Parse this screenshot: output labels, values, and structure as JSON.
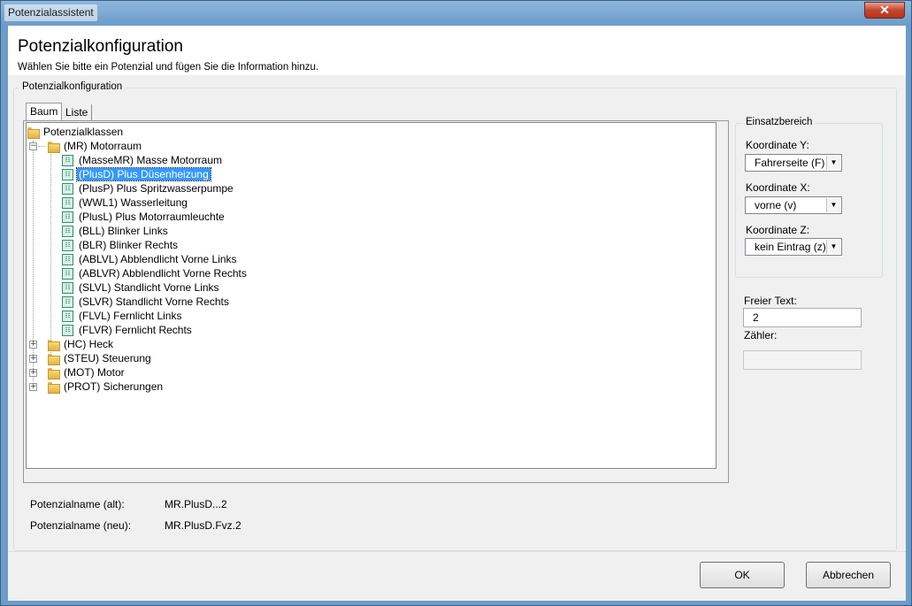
{
  "window": {
    "title": "Potenzialassistent",
    "close_label": "✕"
  },
  "header": {
    "title": "Potenzialkonfiguration",
    "subtitle": "Wählen Sie bitte ein Potenzial und fügen Sie die Information hinzu."
  },
  "config_group": {
    "title": "Potenzialkonfiguration"
  },
  "tabs": [
    {
      "label": "Baum",
      "active": true
    },
    {
      "label": "Liste",
      "active": false
    }
  ],
  "tree": {
    "root_label": "Potenzialklassen",
    "expanded_node": "(MR) Motorraum",
    "children": [
      {
        "label": "(MasseMR) Masse Motorraum"
      },
      {
        "label": "(PlusD) Plus Düsenheizung",
        "selected": true
      },
      {
        "label": "(PlusP) Plus Spritzwasserpumpe"
      },
      {
        "label": "(WWL1) Wasserleitung"
      },
      {
        "label": "(PlusL) Plus Motorraumleuchte"
      },
      {
        "label": "(BLL) Blinker Links"
      },
      {
        "label": "(BLR) Blinker Rechts"
      },
      {
        "label": "(ABLVL) Abblendlicht Vorne Links"
      },
      {
        "label": "(ABLVR) Abblendlicht Vorne Rechts"
      },
      {
        "label": "(SLVL) Standlicht Vorne Links"
      },
      {
        "label": "(SLVR) Standlicht Vorne Rechts"
      },
      {
        "label": "(FLVL) Fernlicht Links"
      },
      {
        "label": "(FLVR) Fernlicht Rechts"
      }
    ],
    "collapsed_nodes": [
      {
        "label": "(HC) Heck"
      },
      {
        "label": "(STEU) Steuerung"
      },
      {
        "label": "(MOT) Motor"
      },
      {
        "label": "(PROT) Sicherungen"
      }
    ],
    "leaf_icon_text": "☷",
    "expander_minus": "−",
    "expander_plus": "+"
  },
  "einsatzbereich": {
    "title": "Einsatzbereich",
    "y_label": "Koordinate Y:",
    "y_value": "Fahrerseite (F)",
    "x_label": "Koordinate X:",
    "x_value": "vorne (v)",
    "z_label": "Koordinate Z:",
    "z_value": "kein Eintrag (z)",
    "dropdown_arrow": "▼"
  },
  "freier_text": {
    "label": "Freier Text:",
    "value": "2"
  },
  "zaehler": {
    "label": "Zähler:",
    "value": ""
  },
  "potenzialname": {
    "alt_label": "Potenzialname (alt):",
    "alt_value": "MR.PlusD...2",
    "neu_label": "Potenzialname (neu):",
    "neu_value": "MR.PlusD.Fvz.2"
  },
  "buttons": {
    "ok": "OK",
    "cancel": "Abbrechen"
  }
}
